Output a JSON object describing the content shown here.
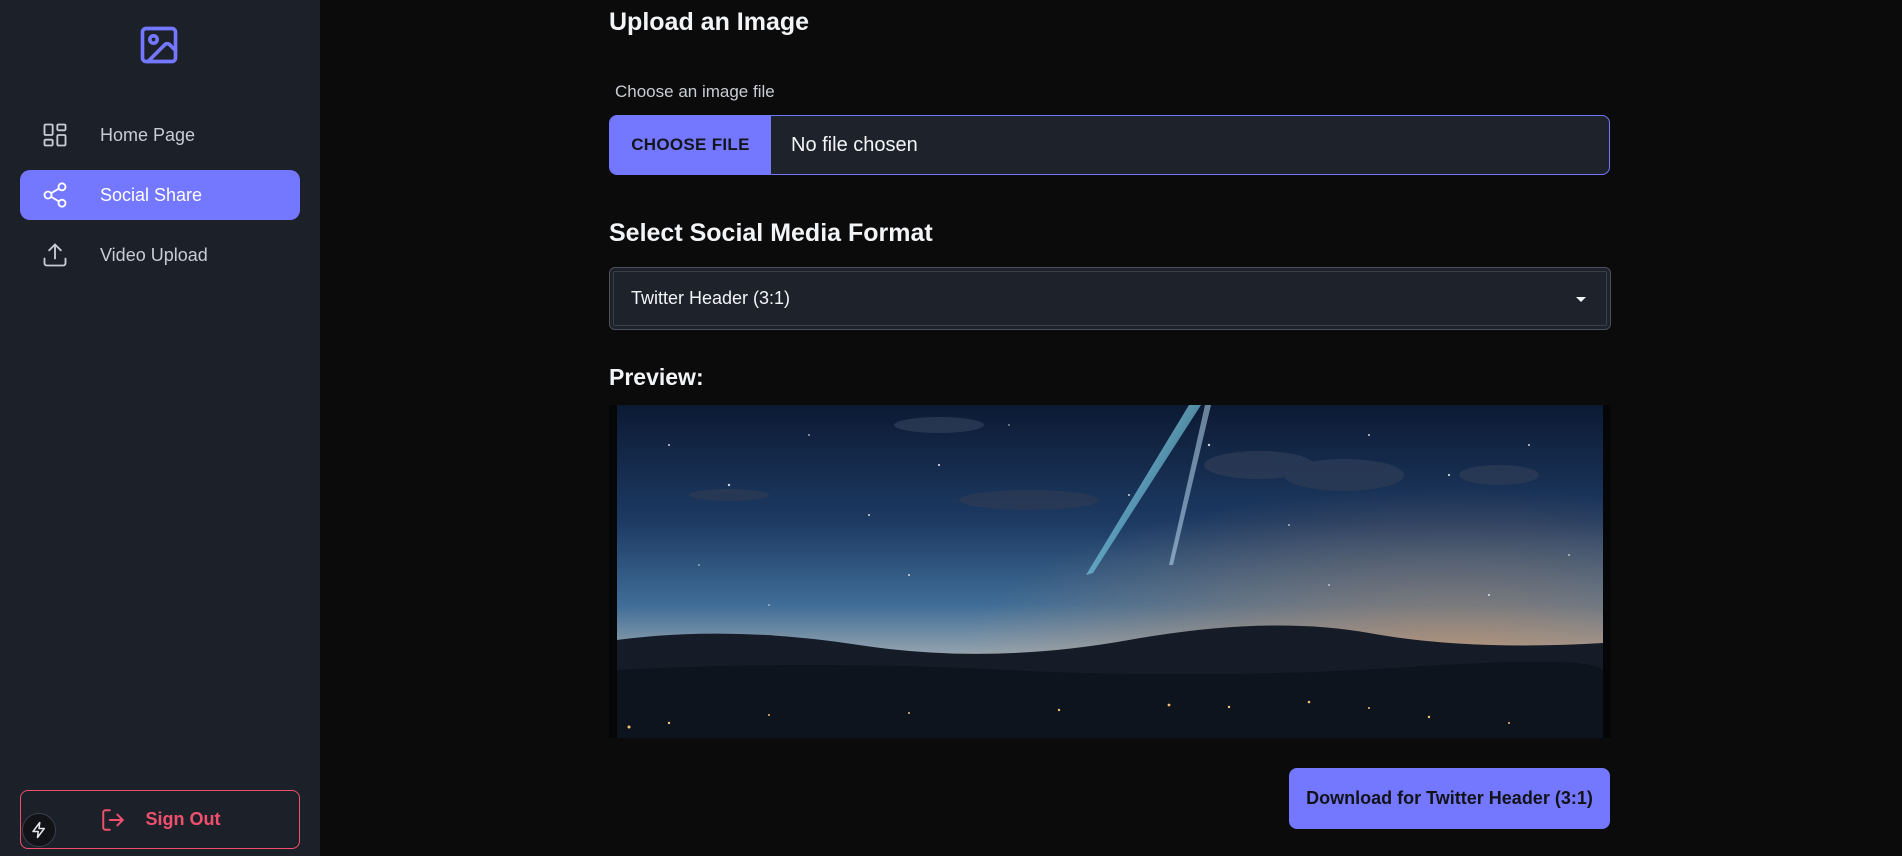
{
  "sidebar": {
    "logo_icon": "image-icon",
    "items": [
      {
        "label": "Home Page",
        "icon": "dashboard-icon",
        "active": false
      },
      {
        "label": "Social Share",
        "icon": "share-icon",
        "active": true
      },
      {
        "label": "Video Upload",
        "icon": "upload-icon",
        "active": false
      }
    ],
    "sign_out_label": "Sign Out",
    "sign_out_icon": "logout-icon",
    "bolt_icon": "lightning-icon"
  },
  "main": {
    "upload_heading": "Upload an Image",
    "file_label": "Choose an image file",
    "file_button": "CHOOSE FILE",
    "file_status": "No file chosen",
    "format_heading": "Select Social Media Format",
    "format_selected": "Twitter Header (3:1)",
    "preview_heading": "Preview:",
    "download_label": "Download for Twitter Header (3:1)"
  },
  "colors": {
    "accent": "#7477ff",
    "sidebar_bg": "#1c2029",
    "page_bg": "#0b0b0c",
    "danger": "#f0506e"
  }
}
